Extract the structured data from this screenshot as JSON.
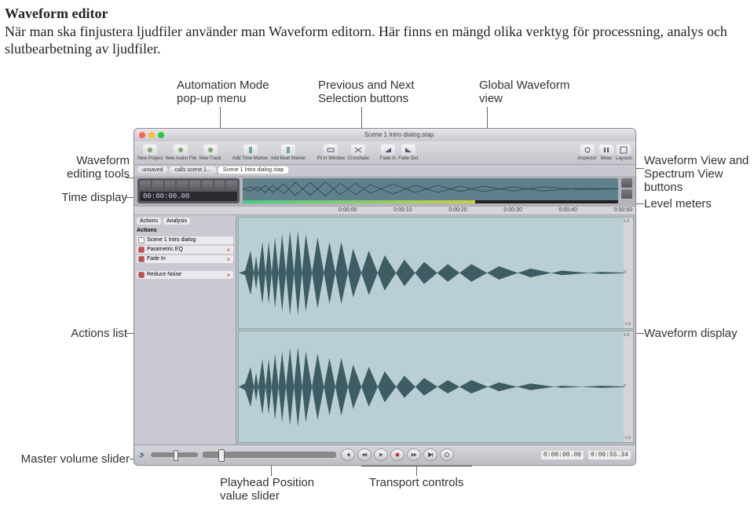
{
  "intro": {
    "title": "Waveform editor",
    "body": "När man ska finjustera ljudfiler använder man Waveform editorn. Här finns en mängd olika verktyg för processning, analys och slutbearbetning av ljudfiler."
  },
  "callouts": {
    "automation_mode": "Automation Mode\npop-up menu",
    "prev_next": "Previous and Next\nSelection buttons",
    "global_waveform": "Global Waveform\nview",
    "editing_tools": "Waveform\nediting tools",
    "time_display": "Time display",
    "actions_list": "Actions list",
    "master_volume": "Master volume slider",
    "view_buttons": "Waveform View and\nSpectrum View buttons",
    "level_meters": "Level meters",
    "waveform_display": "Waveform display",
    "playhead_slider": "Playhead Position\nvalue slider",
    "transport": "Transport controls"
  },
  "app": {
    "window_title": "Scene 1 Intro dialog.stap",
    "toolbar": {
      "new_project": "New Project",
      "new_audio_file": "New Audio File",
      "new_track": "New Track",
      "add_time_marker": "Add Time Marker",
      "add_beat_marker": "Add Beat Marker",
      "fit_in_window": "Fit in Window",
      "crossfade": "Crossfade",
      "fade_in": "Fade In",
      "fade_out": "Fade Out",
      "inspector": "Inspector",
      "mixer": "Mixer",
      "layouts": "Layouts"
    },
    "tabs": {
      "unsaved": "unsaved",
      "file": "calls scene 1...",
      "current": "Scene 1 Intro dialog.stap"
    },
    "timecode": "00:00:00.00",
    "ruler": [
      "0:00:00",
      "0:00:10",
      "0:00:20",
      "0:00:30",
      "0:00:40",
      "0:00:50"
    ],
    "sidepanel": {
      "segments": [
        "Actions",
        "Analysis"
      ],
      "header": "Actions",
      "actions": [
        {
          "label": "Scene 1 Intro dialog",
          "checked": false
        },
        {
          "label": "Parametric EQ",
          "checked": true
        },
        {
          "label": "Fade In",
          "checked": true
        },
        {
          "label": "Reduce Noise",
          "checked": true
        }
      ]
    },
    "scale": {
      "top": "1.0",
      "mid": "0",
      "bot": "-1.0"
    },
    "bottombar": {
      "readout_a": "0:00:00.00",
      "readout_b": "0:00:55.34"
    }
  }
}
